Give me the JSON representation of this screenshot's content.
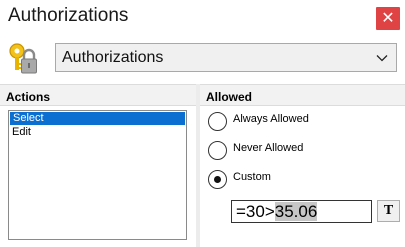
{
  "window": {
    "title": "Authorizations",
    "close_glyph": "✕"
  },
  "selector": {
    "icon": "lock-icon",
    "value": "Authorizations"
  },
  "actions_panel": {
    "header": "Actions",
    "items": [
      {
        "label": "Select",
        "selected": true
      },
      {
        "label": "Edit",
        "selected": false
      }
    ]
  },
  "allowed_panel": {
    "header": "Allowed",
    "options": [
      {
        "label": "Always Allowed",
        "checked": false
      },
      {
        "label": "Never Allowed",
        "checked": false
      },
      {
        "label": "Custom",
        "checked": true
      }
    ],
    "expression": {
      "prefix": "=30>",
      "selected": "35.06"
    },
    "t_button_label": "T"
  },
  "colors": {
    "close": "#e04343",
    "selection": "#0a6fd1",
    "lock_gold": "#e8b400"
  }
}
